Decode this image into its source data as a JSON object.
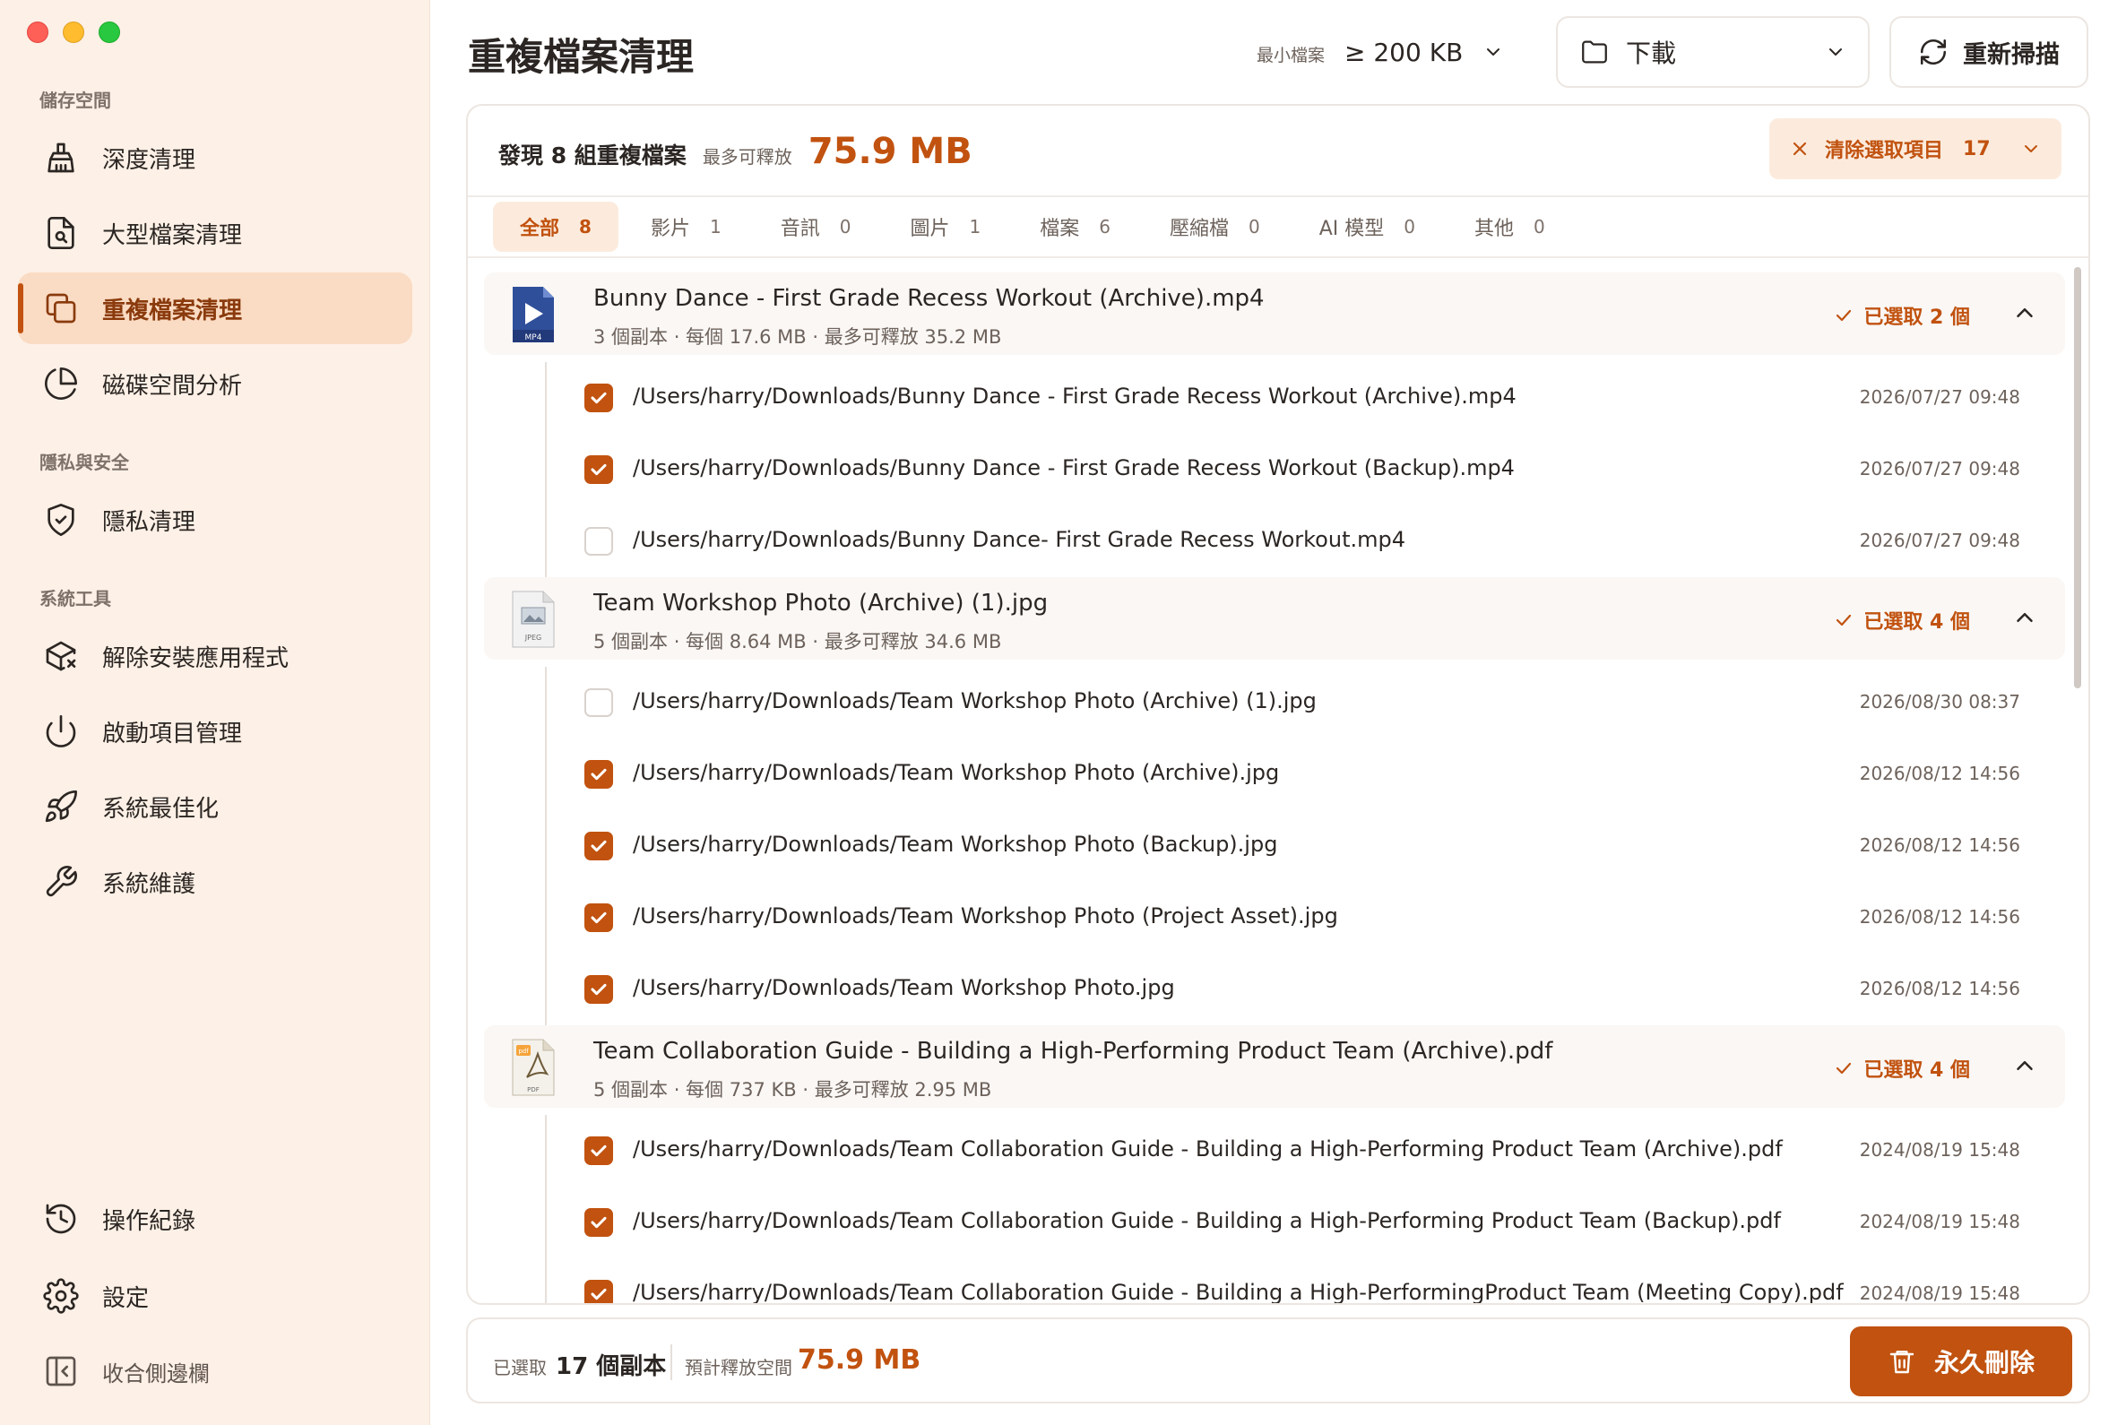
{
  "app": {
    "title": "重複檔案清理"
  },
  "sidebar": {
    "sections": [
      {
        "title": "儲存空間"
      },
      {
        "title": "隱私與安全"
      },
      {
        "title": "系統工具"
      }
    ],
    "items": [
      {
        "label": "深度清理",
        "icon": "broom-icon"
      },
      {
        "label": "大型檔案清理",
        "icon": "file-search-icon"
      },
      {
        "label": "重複檔案清理",
        "icon": "copy-icon",
        "active": true
      },
      {
        "label": "磁碟空間分析",
        "icon": "pie-chart-icon"
      },
      {
        "label": "隱私清理",
        "icon": "shield-check-icon"
      },
      {
        "label": "解除安裝應用程式",
        "icon": "package-remove-icon"
      },
      {
        "label": "啟動項目管理",
        "icon": "power-icon"
      },
      {
        "label": "系統最佳化",
        "icon": "rocket-icon"
      },
      {
        "label": "系統維護",
        "icon": "wrench-icon"
      },
      {
        "label": "操作紀錄",
        "icon": "history-icon"
      },
      {
        "label": "設定",
        "icon": "gear-icon"
      },
      {
        "label": "收合側邊欄",
        "icon": "sidebar-collapse-icon"
      }
    ]
  },
  "header": {
    "min_size_label": "最小檔案",
    "min_size_value": "≥ 200 KB",
    "folder_value": "下載",
    "rescan_label": "重新掃描"
  },
  "summary": {
    "found_text": "發現 8 組重複檔案",
    "max_free_label": "最多可釋放",
    "max_free_value": "75.9 MB",
    "clear_selection_label": "清除選取項目",
    "clear_selection_count": "17"
  },
  "tabs": [
    {
      "label": "全部",
      "count": "8",
      "active": true
    },
    {
      "label": "影片",
      "count": "1"
    },
    {
      "label": "音訊",
      "count": "0"
    },
    {
      "label": "圖片",
      "count": "1"
    },
    {
      "label": "檔案",
      "count": "6"
    },
    {
      "label": "壓縮檔",
      "count": "0"
    },
    {
      "label": "AI 模型",
      "count": "0"
    },
    {
      "label": "其他",
      "count": "0"
    }
  ],
  "groups": [
    {
      "name": "Bunny Dance - First Grade Recess Workout (Archive).mp4",
      "meta": "3 個副本 · 每個 17.6 MB · 最多可釋放 35.2 MB",
      "selected": "已選取 2 個",
      "icon": "mp4-video-icon",
      "files": [
        {
          "path": "/Users/harry/Downloads/Bunny Dance - First Grade Recess Workout (Archive).mp4",
          "date": "2026/07/27 09:48",
          "checked": true
        },
        {
          "path": "/Users/harry/Downloads/Bunny Dance - First Grade Recess Workout (Backup).mp4",
          "date": "2026/07/27 09:48",
          "checked": true
        },
        {
          "path": "/Users/harry/Downloads/Bunny Dance- First Grade Recess Workout.mp4",
          "date": "2026/07/27 09:48",
          "checked": false
        }
      ]
    },
    {
      "name": "Team Workshop Photo (Archive) (1).jpg",
      "meta": "5 個副本 · 每個 8.64 MB · 最多可釋放 34.6 MB",
      "selected": "已選取 4 個",
      "icon": "jpeg-image-icon",
      "files": [
        {
          "path": "/Users/harry/Downloads/Team Workshop Photo (Archive) (1).jpg",
          "date": "2026/08/30 08:37",
          "checked": false
        },
        {
          "path": "/Users/harry/Downloads/Team Workshop Photo (Archive).jpg",
          "date": "2026/08/12 14:56",
          "checked": true
        },
        {
          "path": "/Users/harry/Downloads/Team Workshop Photo (Backup).jpg",
          "date": "2026/08/12 14:56",
          "checked": true
        },
        {
          "path": "/Users/harry/Downloads/Team Workshop Photo (Project Asset).jpg",
          "date": "2026/08/12 14:56",
          "checked": true
        },
        {
          "path": "/Users/harry/Downloads/Team Workshop Photo.jpg",
          "date": "2026/08/12 14:56",
          "checked": true
        }
      ]
    },
    {
      "name": "Team Collaboration Guide - Building a High-Performing Product Team (Archive).pdf",
      "meta": "5 個副本 · 每個 737 KB · 最多可釋放 2.95 MB",
      "selected": "已選取 4 個",
      "icon": "pdf-document-icon",
      "files": [
        {
          "path": "/Users/harry/Downloads/Team Collaboration Guide - Building a High-Performing Product Team (Archive).pdf",
          "date": "2024/08/19 15:48",
          "checked": true
        },
        {
          "path": "/Users/harry/Downloads/Team Collaboration Guide - Building a High-Performing Product Team (Backup).pdf",
          "date": "2024/08/19 15:48",
          "checked": true
        },
        {
          "path": "/Users/harry/Downloads/Team Collaboration Guide - Building a High-PerformingProduct Team (Meeting Copy).pdf",
          "date": "2024/08/19 15:48",
          "checked": true
        }
      ]
    }
  ],
  "footer": {
    "selected_label": "已選取",
    "selected_value": "17 個副本",
    "estimated_label": "預計釋放空間",
    "estimated_value": "75.9 MB",
    "delete_label": "永久刪除"
  },
  "colors": {
    "accent": "#c1520f",
    "sidebar_bg": "#fdf0e6",
    "active_bg": "#fadbc3"
  }
}
